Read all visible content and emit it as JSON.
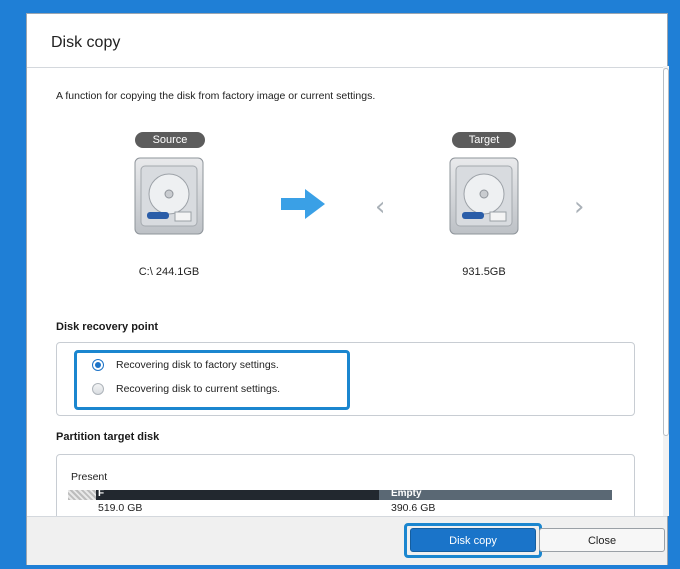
{
  "window": {
    "title": "Disk copy"
  },
  "intro": {
    "description": "A function for copying the disk from factory image or current settings."
  },
  "source": {
    "badge": "Source",
    "label": "C:\\ 244.1GB"
  },
  "target": {
    "badge": "Target",
    "label": "931.5GB"
  },
  "navigation": {
    "prev_symbol": "‹",
    "next_symbol": "›"
  },
  "recovery": {
    "title": "Disk recovery point",
    "options": [
      {
        "label": "Recovering disk to factory settings.",
        "selected": true
      },
      {
        "label": "Recovering disk to current settings.",
        "selected": false
      }
    ]
  },
  "partition": {
    "title": "Partition target disk",
    "present_label": "Present",
    "used": {
      "label": "F",
      "size": "519.0 GB",
      "color": "#22282f"
    },
    "empty": {
      "label": "Empty",
      "size": "390.6 GB",
      "color": "#5a6874"
    }
  },
  "footer": {
    "primary_label": "Disk copy",
    "secondary_label": "Close"
  },
  "colors": {
    "accent": "#1b86cf",
    "arrow": "#3aa0e6",
    "pill": "#5c5c5c"
  }
}
